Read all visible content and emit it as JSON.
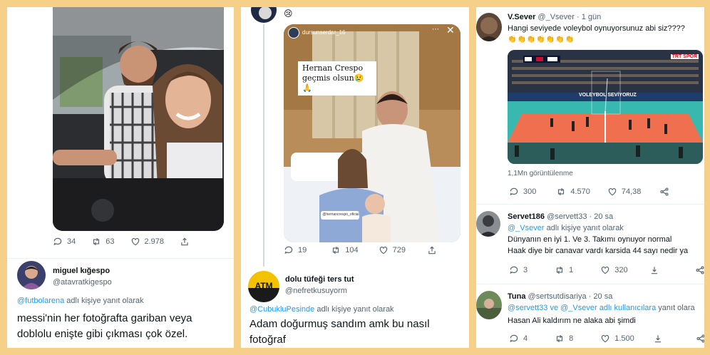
{
  "panel1": {
    "stats": {
      "replies": "34",
      "retweets": "63",
      "likes": "2.978"
    },
    "reply": {
      "name": "miguel kığespo",
      "handle": "@atavratkigespo",
      "replying_mention": "@futbolarena",
      "replying_suffix": "adlı kişiye yanıt olarak",
      "text": "messi'nin her fotoğrafta gariban veya doblolu enişte gibi çıkması çok özel."
    }
  },
  "panel2": {
    "story": {
      "username": "dursunserdar_16",
      "caption": "Hernan Crespo geçmis olsun😢🙏",
      "sticker": "@hernancrespo_oficial"
    },
    "stats": {
      "replies": "19",
      "retweets": "104",
      "likes": "729"
    },
    "reply": {
      "name": "dolu tüfeği ters tut",
      "handle": "@nefretkusuyorm",
      "avatar_text": "ATM",
      "replying_mention": "@CubukluPesinde",
      "replying_suffix": "adlı kişiye yanıt olarak",
      "text": "Adam doğurmuş sandım amk bu nasıl fotoğraf"
    }
  },
  "panel3": {
    "tweet": {
      "name": "V.Sever",
      "handle": "@_Vsever",
      "time": "· 1 gün",
      "text": "Hangi seviyede voleybol oynuyorsunuz abi siz????",
      "emojis": "👏👏👏👏👏👏👏",
      "banner": "VOLEYBOL SEVİYORUZ",
      "broadcaster": "TRT SPOR",
      "views": "1,1Mn görüntülenme",
      "stats": {
        "replies": "300",
        "retweets": "4.570",
        "likes": "74,38"
      }
    },
    "reply1": {
      "name": "Servet186",
      "handle": "@servett33",
      "time": "· 20 sa",
      "replying_mention": "@_Vsever",
      "replying_suffix": "adlı kişiye yanıt olarak",
      "line1": "Dünyanın en iyi 1. Ve 3. Takımı oynuyor normal",
      "line2": "Haak diye bir canavar vardı karsida 44 sayı nedir ya",
      "stats": {
        "replies": "3",
        "retweets": "1",
        "likes": "320"
      }
    },
    "reply2": {
      "name": "Tuna",
      "handle": "@sertsutdisariya",
      "time": "· 20 sa",
      "replying_mention": "@servett33 ve @_Vsever adlı kullanıcılara",
      "replying_suffix": "yanıt olara",
      "text": "Hasan Ali kaldırım ne alaka abi şimdi",
      "stats": {
        "replies": "4",
        "retweets": "8",
        "likes": "1.500"
      }
    }
  },
  "colors": {
    "link": "#1d9bf0",
    "muted": "#536471",
    "court": "#ef6f4e",
    "floor": "#39b8b0"
  }
}
